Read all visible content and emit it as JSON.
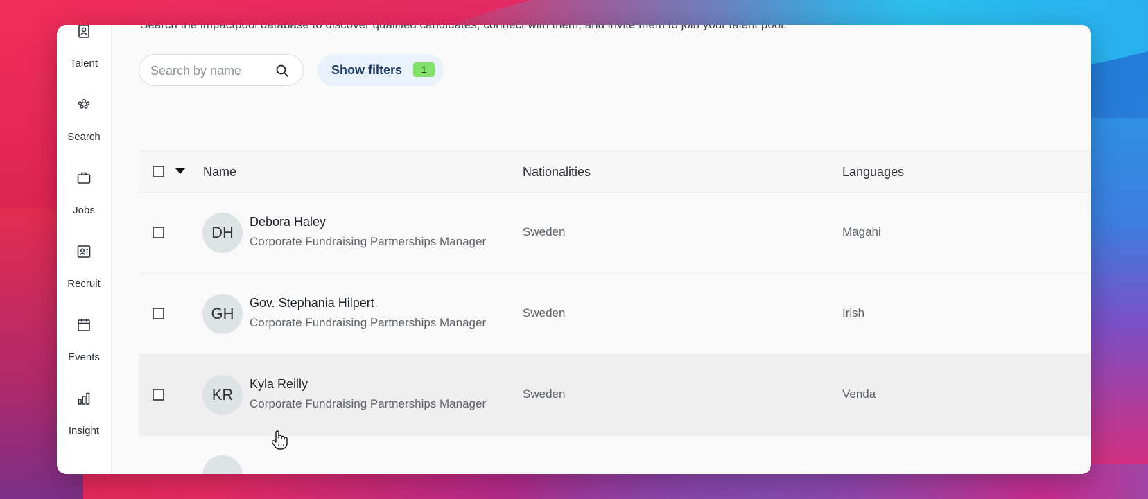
{
  "sidebar": {
    "items": [
      {
        "label": "Talent",
        "icon": "contact-card-icon"
      },
      {
        "label": "Search",
        "icon": "people-group-icon"
      },
      {
        "label": "Jobs",
        "icon": "briefcase-icon"
      },
      {
        "label": "Recruit",
        "icon": "id-card-icon"
      },
      {
        "label": "Events",
        "icon": "calendar-icon"
      },
      {
        "label": "Insight",
        "icon": "bar-chart-icon"
      }
    ]
  },
  "header": {
    "subtitle": "Search the impactpool database to discover qualified candidates, connect with them, and invite them to join your talent pool."
  },
  "search": {
    "placeholder": "Search by name",
    "value": ""
  },
  "filters": {
    "label": "Show filters",
    "count": "1"
  },
  "table": {
    "columns": [
      "Name",
      "Nationalities",
      "Languages"
    ],
    "rows": [
      {
        "initials": "DH",
        "name": "Debora Haley",
        "role": "Corporate Fundraising Partnerships Manager",
        "nationality": "Sweden",
        "language": "Magahi"
      },
      {
        "initials": "GH",
        "name": "Gov. Stephania Hilpert",
        "role": "Corporate Fundraising Partnerships Manager",
        "nationality": "Sweden",
        "language": "Irish"
      },
      {
        "initials": "KR",
        "name": "Kyla Reilly",
        "role": "Corporate Fundraising Partnerships Manager",
        "nationality": "Sweden",
        "language": "Venda"
      }
    ]
  },
  "colors": {
    "filter_bg": "#e9f2fb",
    "filter_text": "#1f3d63",
    "badge": "#83e06a",
    "avatar_bg": "#dde3e5",
    "row_hover": "#efefef"
  }
}
